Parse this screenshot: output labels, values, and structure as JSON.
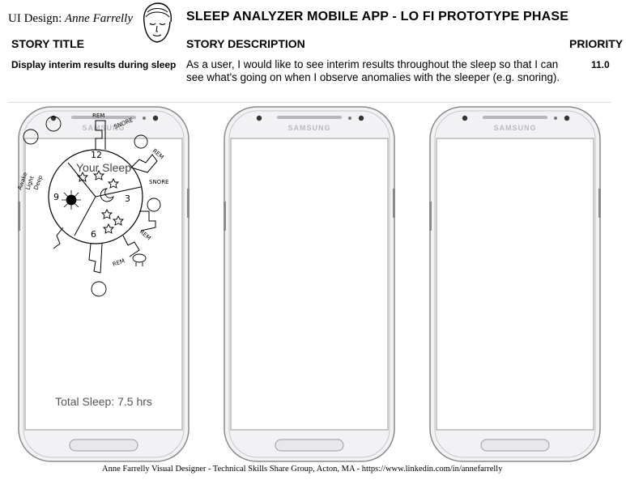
{
  "header": {
    "designer_prefix": "UI Design",
    "designer_name": "Anne Farrelly",
    "app_title": "SLEEP  ANALYZER  MOBILE  APP -  LO FI PROTOTYPE PHASE",
    "logo_icon": "woman-face-sketch-icon"
  },
  "columns": {
    "story_title": "STORY TITLE",
    "story_description": "STORY DESCRIPTION",
    "priority": "PRIORITY"
  },
  "story": {
    "title": "Display interim results during sleep",
    "description": "As a user, I would like to see interim results throughout the sleep so that I can see what's going on when I observe anomalies with the sleeper (e.g. snoring).",
    "priority": "11.0"
  },
  "phones": [
    {
      "brand": "SAMSUNG",
      "screen_title": "Your Sleep",
      "total_sleep": "Total Sleep:  7.5 hrs"
    },
    {
      "brand": "SAMSUNG"
    },
    {
      "brand": "SAMSUNG"
    }
  ],
  "sketch": {
    "clock_numbers": [
      "12",
      "3",
      "6",
      "9"
    ],
    "labels": [
      "REM",
      "SNORE",
      "REM",
      "SNORE",
      "REM",
      "REM",
      "Awake",
      "Light",
      "Deep"
    ]
  },
  "footer": "Anne Farrelly  Visual Designer -  Technical Skills Share Group, Acton,  MA  - https://www.linkedin.com/in/annefarrelly",
  "colors": {
    "phone_body": "#f2f2f4",
    "phone_outline": "#8a8a8e",
    "text": "#000000"
  }
}
